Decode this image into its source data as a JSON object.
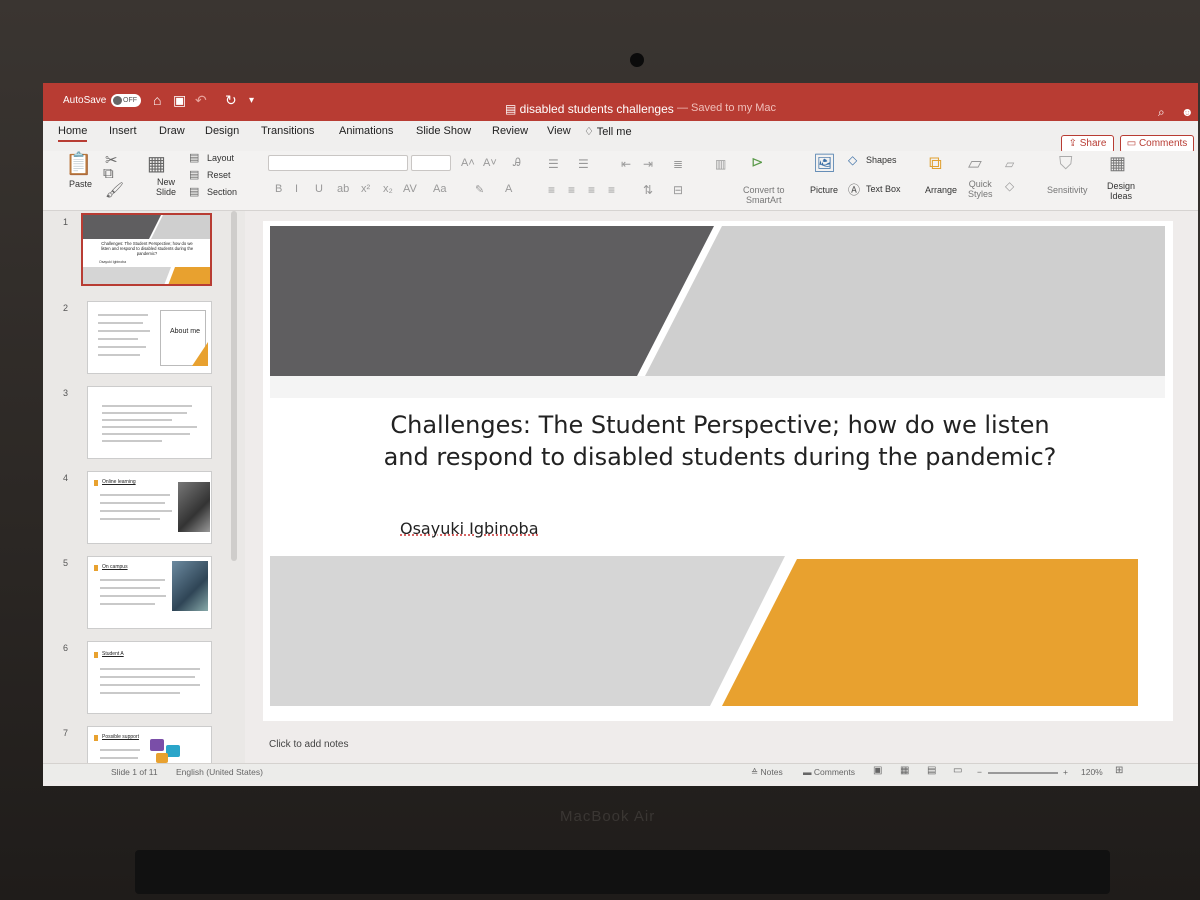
{
  "titlebar": {
    "autosave_label": "AutoSave",
    "autosave_state": "OFF",
    "document_title": "disabled students challenges",
    "saved_status": "— Saved to my Mac",
    "accent_color": "#b83c33"
  },
  "tabs": [
    {
      "label": "Home"
    },
    {
      "label": "Insert"
    },
    {
      "label": "Draw"
    },
    {
      "label": "Design"
    },
    {
      "label": "Transitions"
    },
    {
      "label": "Animations"
    },
    {
      "label": "Slide Show"
    },
    {
      "label": "Review"
    },
    {
      "label": "View"
    },
    {
      "label": "Tell me"
    }
  ],
  "actions": {
    "share": "Share",
    "comments": "Comments"
  },
  "ribbon": {
    "paste": "Paste",
    "new_slide": "New\nSlide",
    "layout": "Layout",
    "reset": "Reset",
    "section": "Section",
    "convert_smartart": "Convert to\nSmartArt",
    "picture": "Picture",
    "shapes": "Shapes",
    "text_box": "Text Box",
    "arrange": "Arrange",
    "quick_styles": "Quick\nStyles",
    "sensitivity": "Sensitivity",
    "design_ideas": "Design\nIdeas"
  },
  "thumbnails": [
    {
      "number": "1",
      "title": "Challenges: The Student Perspective; how do we listen and respond to disabled students during the pandemic?",
      "author": "Osayuki Igbinoba"
    },
    {
      "number": "2",
      "title": "About me"
    },
    {
      "number": "3"
    },
    {
      "number": "4",
      "title": "Online learning"
    },
    {
      "number": "5",
      "title": "On campus"
    },
    {
      "number": "6",
      "title": "Student A"
    },
    {
      "number": "7",
      "title": "Possible support"
    }
  ],
  "slide": {
    "title": "Challenges: The Student Perspective; how do we listen and respond to disabled students during the pandemic?",
    "subtitle": "Osayuki Igbinoba",
    "colors": {
      "dark_gray": "#5f5e60",
      "light_gray": "#cfcfcf",
      "orange": "#e8a12f"
    }
  },
  "notes_placeholder": "Click to add notes",
  "statusbar": {
    "slide_counter": "Slide 1 of 11",
    "language": "English (United States)",
    "notes": "Notes",
    "comments": "Comments",
    "zoom": "120%"
  },
  "laptop": {
    "brand": "MacBook Air"
  }
}
